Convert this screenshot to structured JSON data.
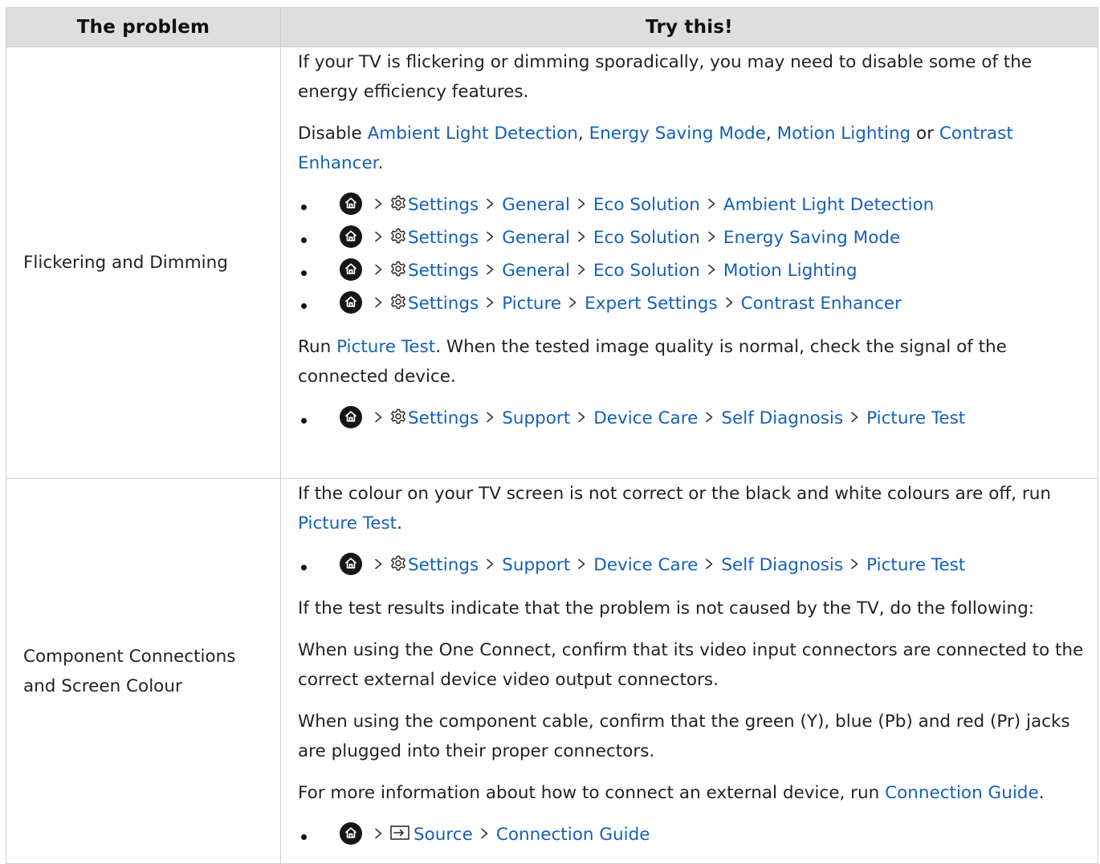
{
  "header": {
    "col_problem": "The problem",
    "col_try": "Try this!"
  },
  "rows": [
    {
      "problem": "Flickering and Dimming",
      "intro": "If your TV is flickering or dimming sporadically, you may need to disable some of the energy efficiency features.",
      "disable_text": {
        "lead": "Disable ",
        "ambient": "Ambient Light Detection",
        "sep1": ", ",
        "energy": "Energy Saving Mode",
        "sep2": ", ",
        "motion": "Motion Lighting",
        "or": " or ",
        "contrast": "Contrast Enhancer",
        "end": "."
      },
      "paths": [
        [
          "Settings",
          "General",
          "Eco Solution",
          "Ambient Light Detection"
        ],
        [
          "Settings",
          "General",
          "Eco Solution",
          "Energy Saving Mode"
        ],
        [
          "Settings",
          "General",
          "Eco Solution",
          "Motion Lighting"
        ],
        [
          "Settings",
          "Picture",
          "Expert Settings",
          "Contrast Enhancer"
        ]
      ],
      "run_text": {
        "lead": "Run ",
        "link": "Picture Test",
        "rest": ". When the tested image quality is normal, check the signal of the connected device."
      },
      "path_test": [
        "Settings",
        "Support",
        "Device Care",
        "Self Diagnosis",
        "Picture Test"
      ]
    },
    {
      "problem": "Component Connections and Screen Colour",
      "colour_text": {
        "lead": "If the colour on your TV screen is not correct or the black and white colours are off, run ",
        "link": "Picture Test",
        "end": "."
      },
      "path_test": [
        "Settings",
        "Support",
        "Device Care",
        "Self Diagnosis",
        "Picture Test"
      ],
      "results_text": "If the test results indicate that the problem is not caused by the TV, do the following:",
      "one_connect_text": "When using the One Connect, confirm that its video input connectors are connected to the correct external device video output connectors.",
      "component_text": "When using the component cable, confirm that the green (Y), blue (Pb) and red (Pr) jacks are plugged into their proper connectors.",
      "more_text": {
        "lead": "For more information about how to connect an external device, run ",
        "link": "Connection Guide",
        "end": "."
      },
      "path_source": [
        "Source",
        "Connection Guide"
      ]
    }
  ]
}
